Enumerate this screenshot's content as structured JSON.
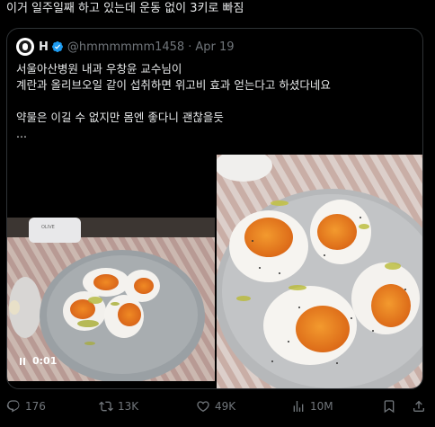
{
  "post": {
    "text": "이거 일주일째 하고 있는데 운동 없이 3키로 빠짐"
  },
  "quote": {
    "name": "H",
    "handle": "@hmmmmmm1458",
    "separator": "·",
    "date": "Apr 19",
    "body": "서울아산병원 내과 우창윤 교수님이\n계란과 올리브오일 같이 섭취하면 위고비 효과 얻는다고 하셨다네요\n\n약물은 이길 수 없지만 몸엔 좋다니 괜찮을듯\n...",
    "verified_color": "#1d9bf0",
    "video": {
      "time": "0:01"
    }
  },
  "actions": {
    "replies": "176",
    "reposts": "13K",
    "likes": "49K",
    "views": "10M"
  },
  "colors": {
    "background": "#000000",
    "text": "#e7e9ea",
    "muted": "#71767b",
    "border": "#2f3336"
  }
}
